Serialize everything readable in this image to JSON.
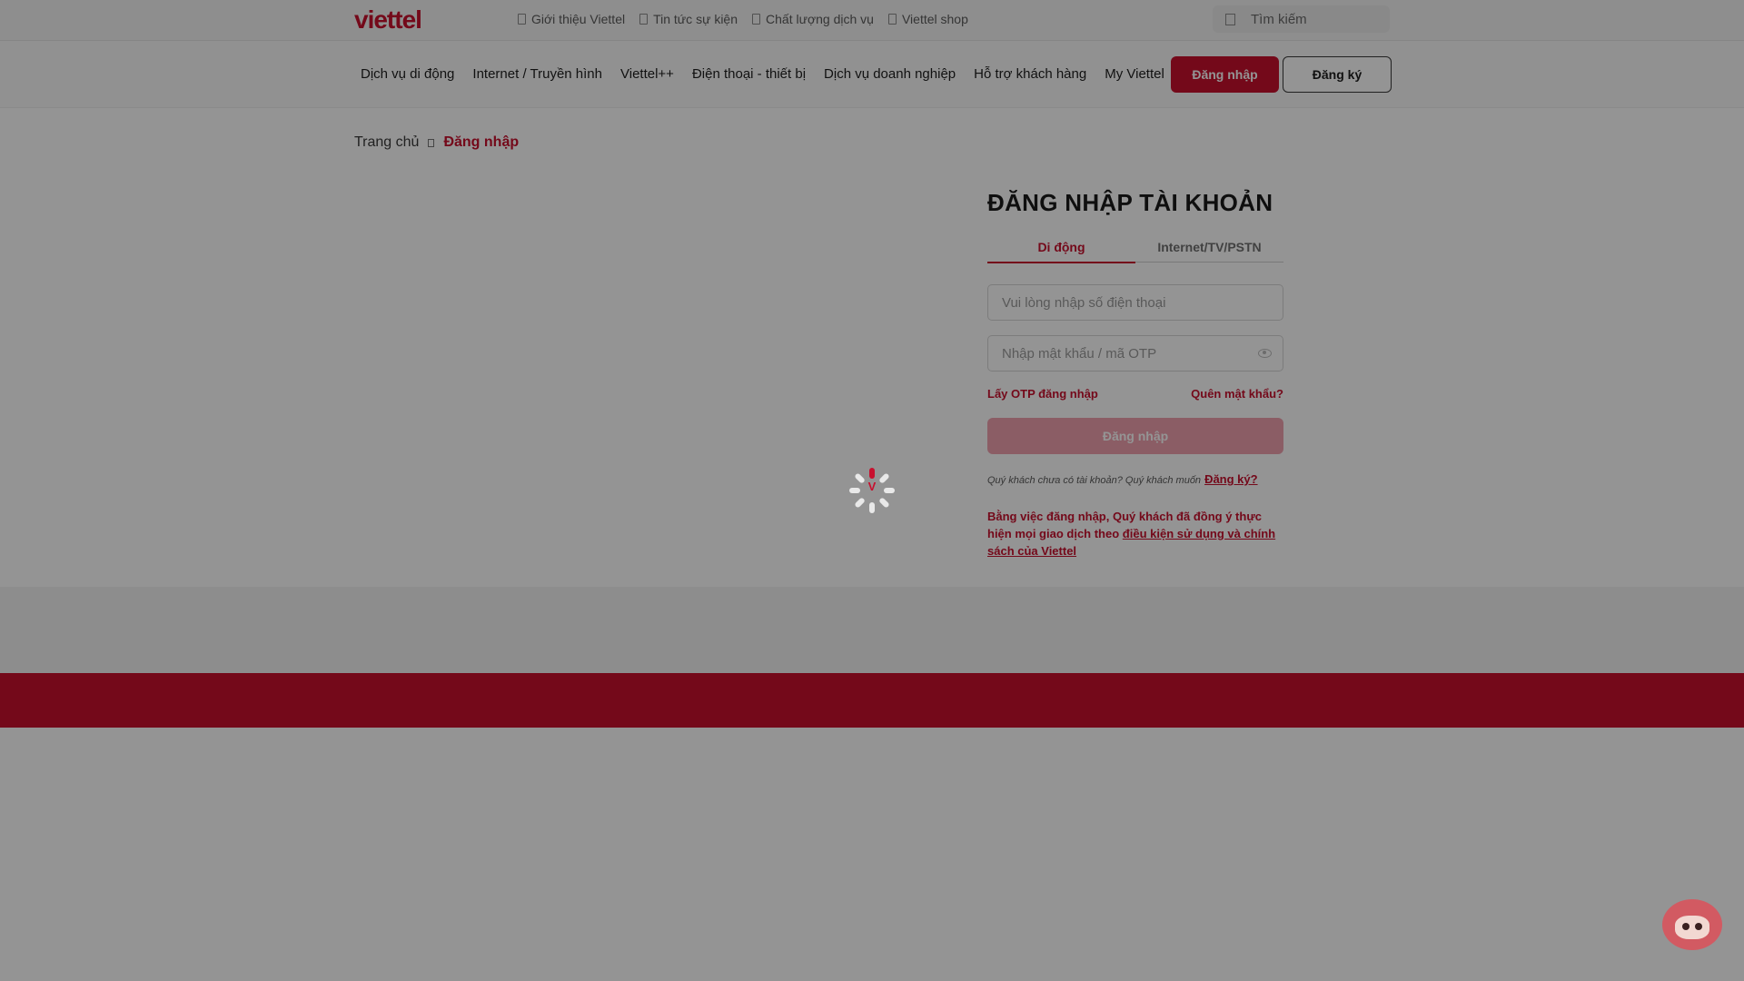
{
  "topbar": {
    "logo": "viettel",
    "links": [
      "Giới thiệu Viettel",
      "Tin tức sự kiện",
      "Chất lượng dịch vụ",
      "Viettel shop"
    ],
    "search_placeholder": "Tìm kiếm"
  },
  "nav": {
    "items": [
      "Dịch vụ di động",
      "Internet / Truyền hình",
      "Viettel++",
      "Điện thoại - thiết bị",
      "Dịch vụ doanh nghiệp",
      "Hỗ trợ khách hàng",
      "My Viettel"
    ],
    "login_label": "Đăng nhập",
    "register_label": "Đăng ký"
  },
  "breadcrumb": {
    "home": "Trang chủ",
    "current": "Đăng nhập"
  },
  "login": {
    "title": "ĐĂNG NHẬP TÀI KHOẢN",
    "tabs": [
      "Di động",
      "Internet/TV/PSTN"
    ],
    "phone_placeholder": "Vui lòng nhập số điện thoại",
    "password_placeholder": "Nhập mật khẩu / mã OTP",
    "otp_link": "Lấy OTP đăng nhập",
    "forgot_link": "Quên mật khẩu?",
    "submit_label": "Đăng nhập",
    "signup_prompt": "Quý khách chưa có tài khoản? Quý khách muốn",
    "signup_link": "Đăng ký?",
    "terms_prefix": "Bằng việc đăng nhập, Quý khách đã đồng ý thực hiện mọi giao dịch theo ",
    "terms_link": "điều kiện sử dụng và chính sách của Viettel"
  },
  "spinner": {
    "letter": "V"
  },
  "colors": {
    "brand": "#c8102e",
    "overlay": "rgba(0,0,0,0.42)"
  }
}
